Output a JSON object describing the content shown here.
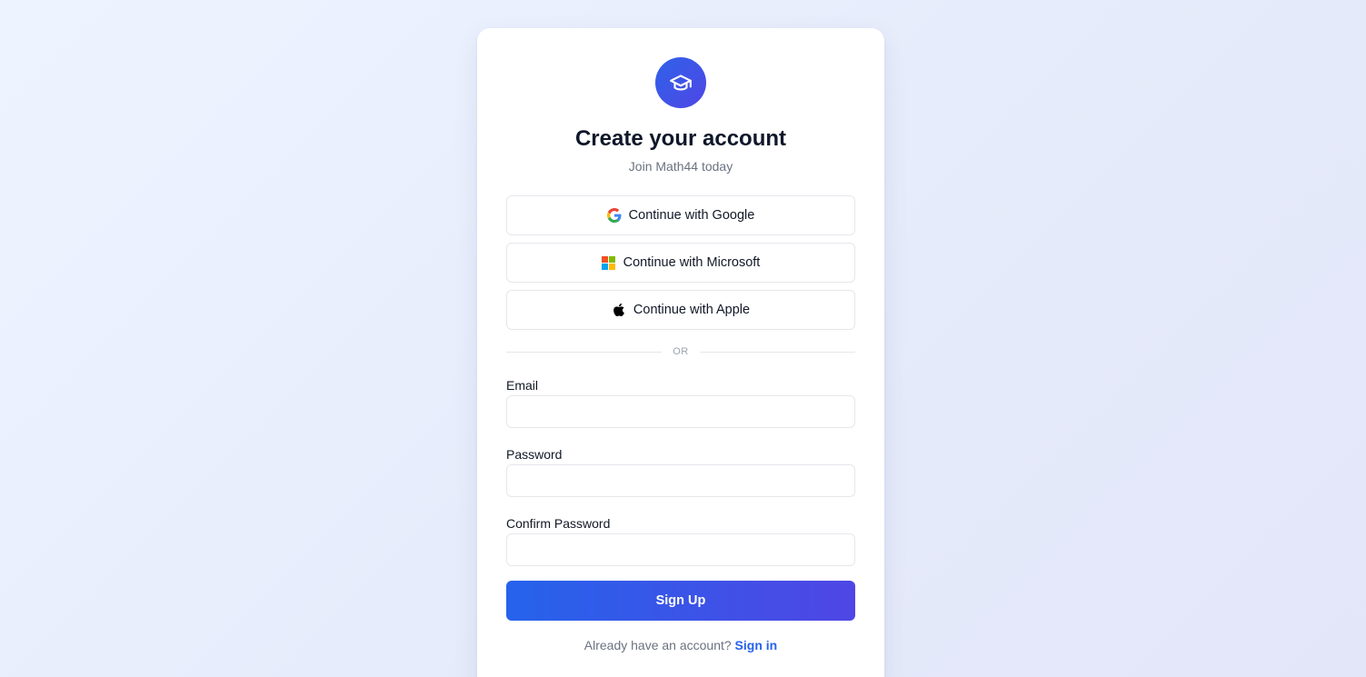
{
  "header": {
    "logo_icon": "graduation-cap-icon",
    "title": "Create your account",
    "subtitle": "Join Math44 today"
  },
  "oauth": {
    "google": {
      "label": "Continue with Google",
      "icon": "google-icon"
    },
    "microsoft": {
      "label": "Continue with Microsoft",
      "icon": "microsoft-icon"
    },
    "apple": {
      "label": "Continue with Apple",
      "icon": "apple-icon"
    }
  },
  "divider": {
    "label": "OR"
  },
  "form": {
    "email": {
      "label": "Email",
      "value": "",
      "placeholder": ""
    },
    "password": {
      "label": "Password",
      "value": "",
      "placeholder": ""
    },
    "confirm_password": {
      "label": "Confirm Password",
      "value": "",
      "placeholder": ""
    },
    "submit_label": "Sign Up"
  },
  "footer": {
    "prompt": "Already have an account?",
    "link_label": "Sign in"
  },
  "colors": {
    "accent": "#2563eb",
    "accent_end": "#4f46e5",
    "background": "#e9effc"
  }
}
